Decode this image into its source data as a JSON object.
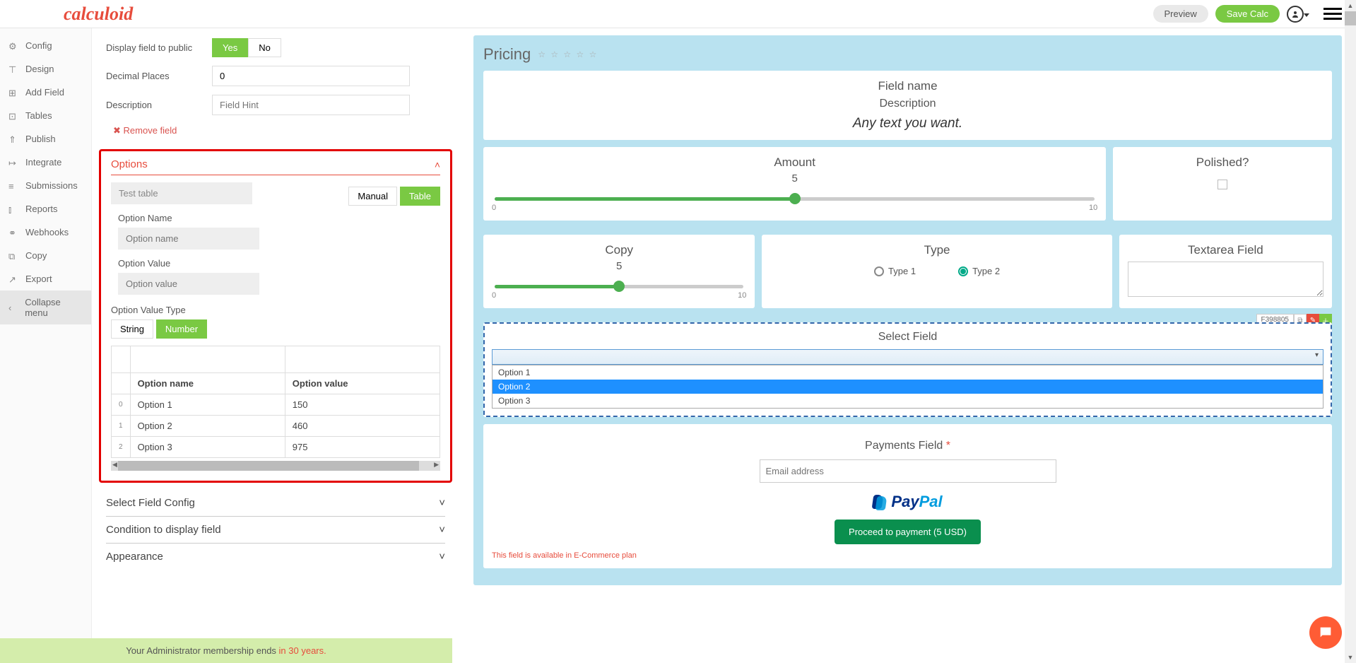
{
  "logo": "calculoid",
  "top": {
    "preview": "Preview",
    "save": "Save Calc"
  },
  "sidebar": {
    "items": [
      {
        "icon": "gear",
        "label": "Config"
      },
      {
        "icon": "design",
        "label": "Design"
      },
      {
        "icon": "plus",
        "label": "Add Field"
      },
      {
        "icon": "table",
        "label": "Tables"
      },
      {
        "icon": "up",
        "label": "Publish"
      },
      {
        "icon": "out",
        "label": "Integrate"
      },
      {
        "icon": "list",
        "label": "Submissions"
      },
      {
        "icon": "chart",
        "label": "Reports"
      },
      {
        "icon": "hook",
        "label": "Webhooks"
      },
      {
        "icon": "copy",
        "label": "Copy"
      },
      {
        "icon": "export",
        "label": "Export"
      }
    ],
    "collapse": "Collapse menu"
  },
  "config": {
    "displayLabel": "Display field to public",
    "yes": "Yes",
    "no": "No",
    "decimalLabel": "Decimal Places",
    "decimalValue": "0",
    "descLabel": "Description",
    "descPlaceholder": "Field Hint",
    "removeField": "Remove field"
  },
  "options": {
    "title": "Options",
    "testTable": "Test table",
    "manual": "Manual",
    "table": "Table",
    "optNameLbl": "Option Name",
    "optNamePh": "Option name",
    "optValLbl": "Option Value",
    "optValPh": "Option value",
    "valTypeLbl": "Option Value Type",
    "string": "String",
    "number": "Number",
    "colName": "Option name",
    "colVal": "Option value",
    "rows": [
      {
        "idx": "0",
        "name": "Option 1",
        "val": "150"
      },
      {
        "idx": "1",
        "name": "Option 2",
        "val": "460"
      },
      {
        "idx": "2",
        "name": "Option 3",
        "val": "975"
      }
    ]
  },
  "sections": {
    "selectCfg": "Select Field Config",
    "condition": "Condition to display field",
    "appearance": "Appearance"
  },
  "footer": {
    "text": "Your Administrator membership ends ",
    "years": "in 30 years."
  },
  "preview": {
    "title": "Pricing",
    "fieldName": "Field name",
    "description": "Description",
    "anyText": "Any text you want.",
    "amount": {
      "label": "Amount",
      "value": "5",
      "min": "0",
      "max": "10"
    },
    "polished": "Polished?",
    "copy": {
      "label": "Copy",
      "value": "5",
      "min": "0",
      "max": "10"
    },
    "type": {
      "label": "Type",
      "opt1": "Type 1",
      "opt2": "Type 2"
    },
    "textarea": "Textarea Field",
    "fieldId": "F398805",
    "selectField": "Select Field",
    "dropOptions": [
      "Option 1",
      "Option 2",
      "Option 3"
    ],
    "payments": "Payments Field",
    "emailPh": "Email address",
    "proceed": "Proceed to payment (5 USD)",
    "ecomNote": "This field is available in E-Commerce plan"
  }
}
